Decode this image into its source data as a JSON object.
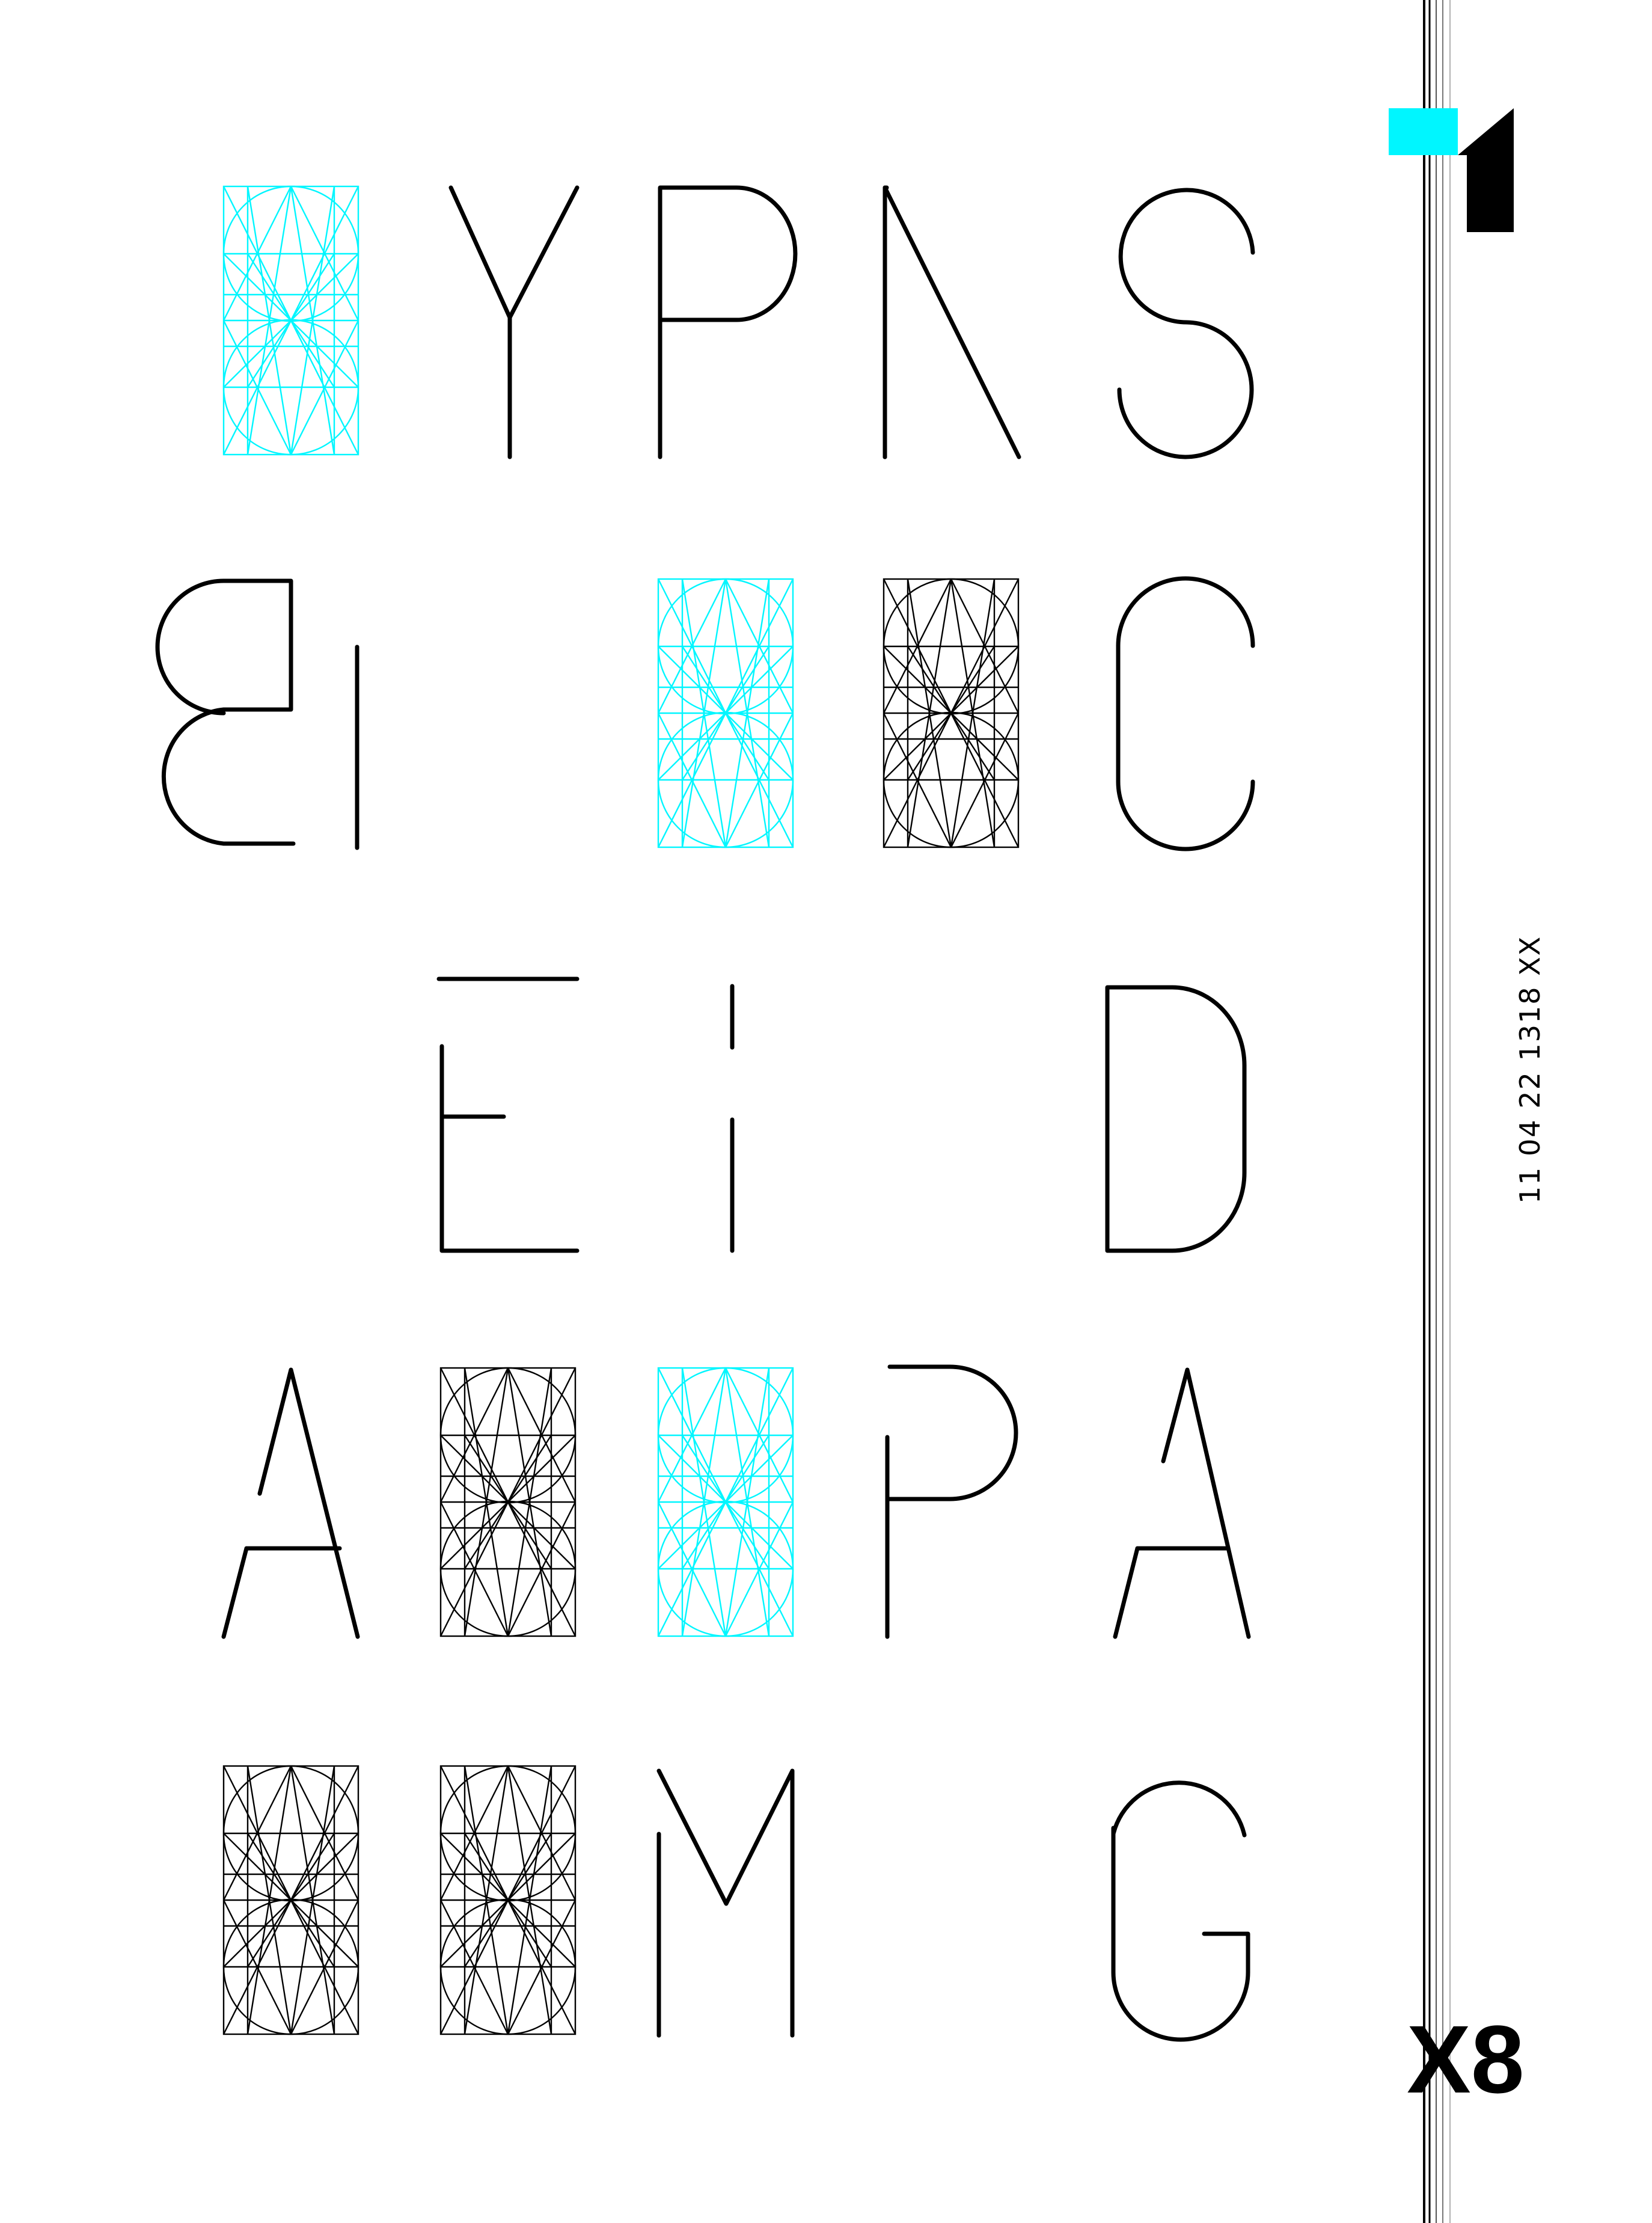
{
  "poster": {
    "letters": {
      "row1": [
        "Y",
        "P",
        "N",
        "S"
      ],
      "row2": [
        "B",
        "C"
      ],
      "row3": [
        "E",
        "I",
        "D"
      ],
      "row4": [
        "A",
        "P",
        "A"
      ],
      "row5": [
        "M",
        "G"
      ]
    },
    "grid_colors": [
      "cyan",
      "cyan",
      "black",
      "black",
      "cyan",
      "black",
      "black"
    ],
    "side_code": "11  04  22  1318 XX",
    "badge": "X8",
    "colors": {
      "ink": "#000000",
      "accent": "#00f6ff",
      "paper": "#ffffff"
    }
  }
}
